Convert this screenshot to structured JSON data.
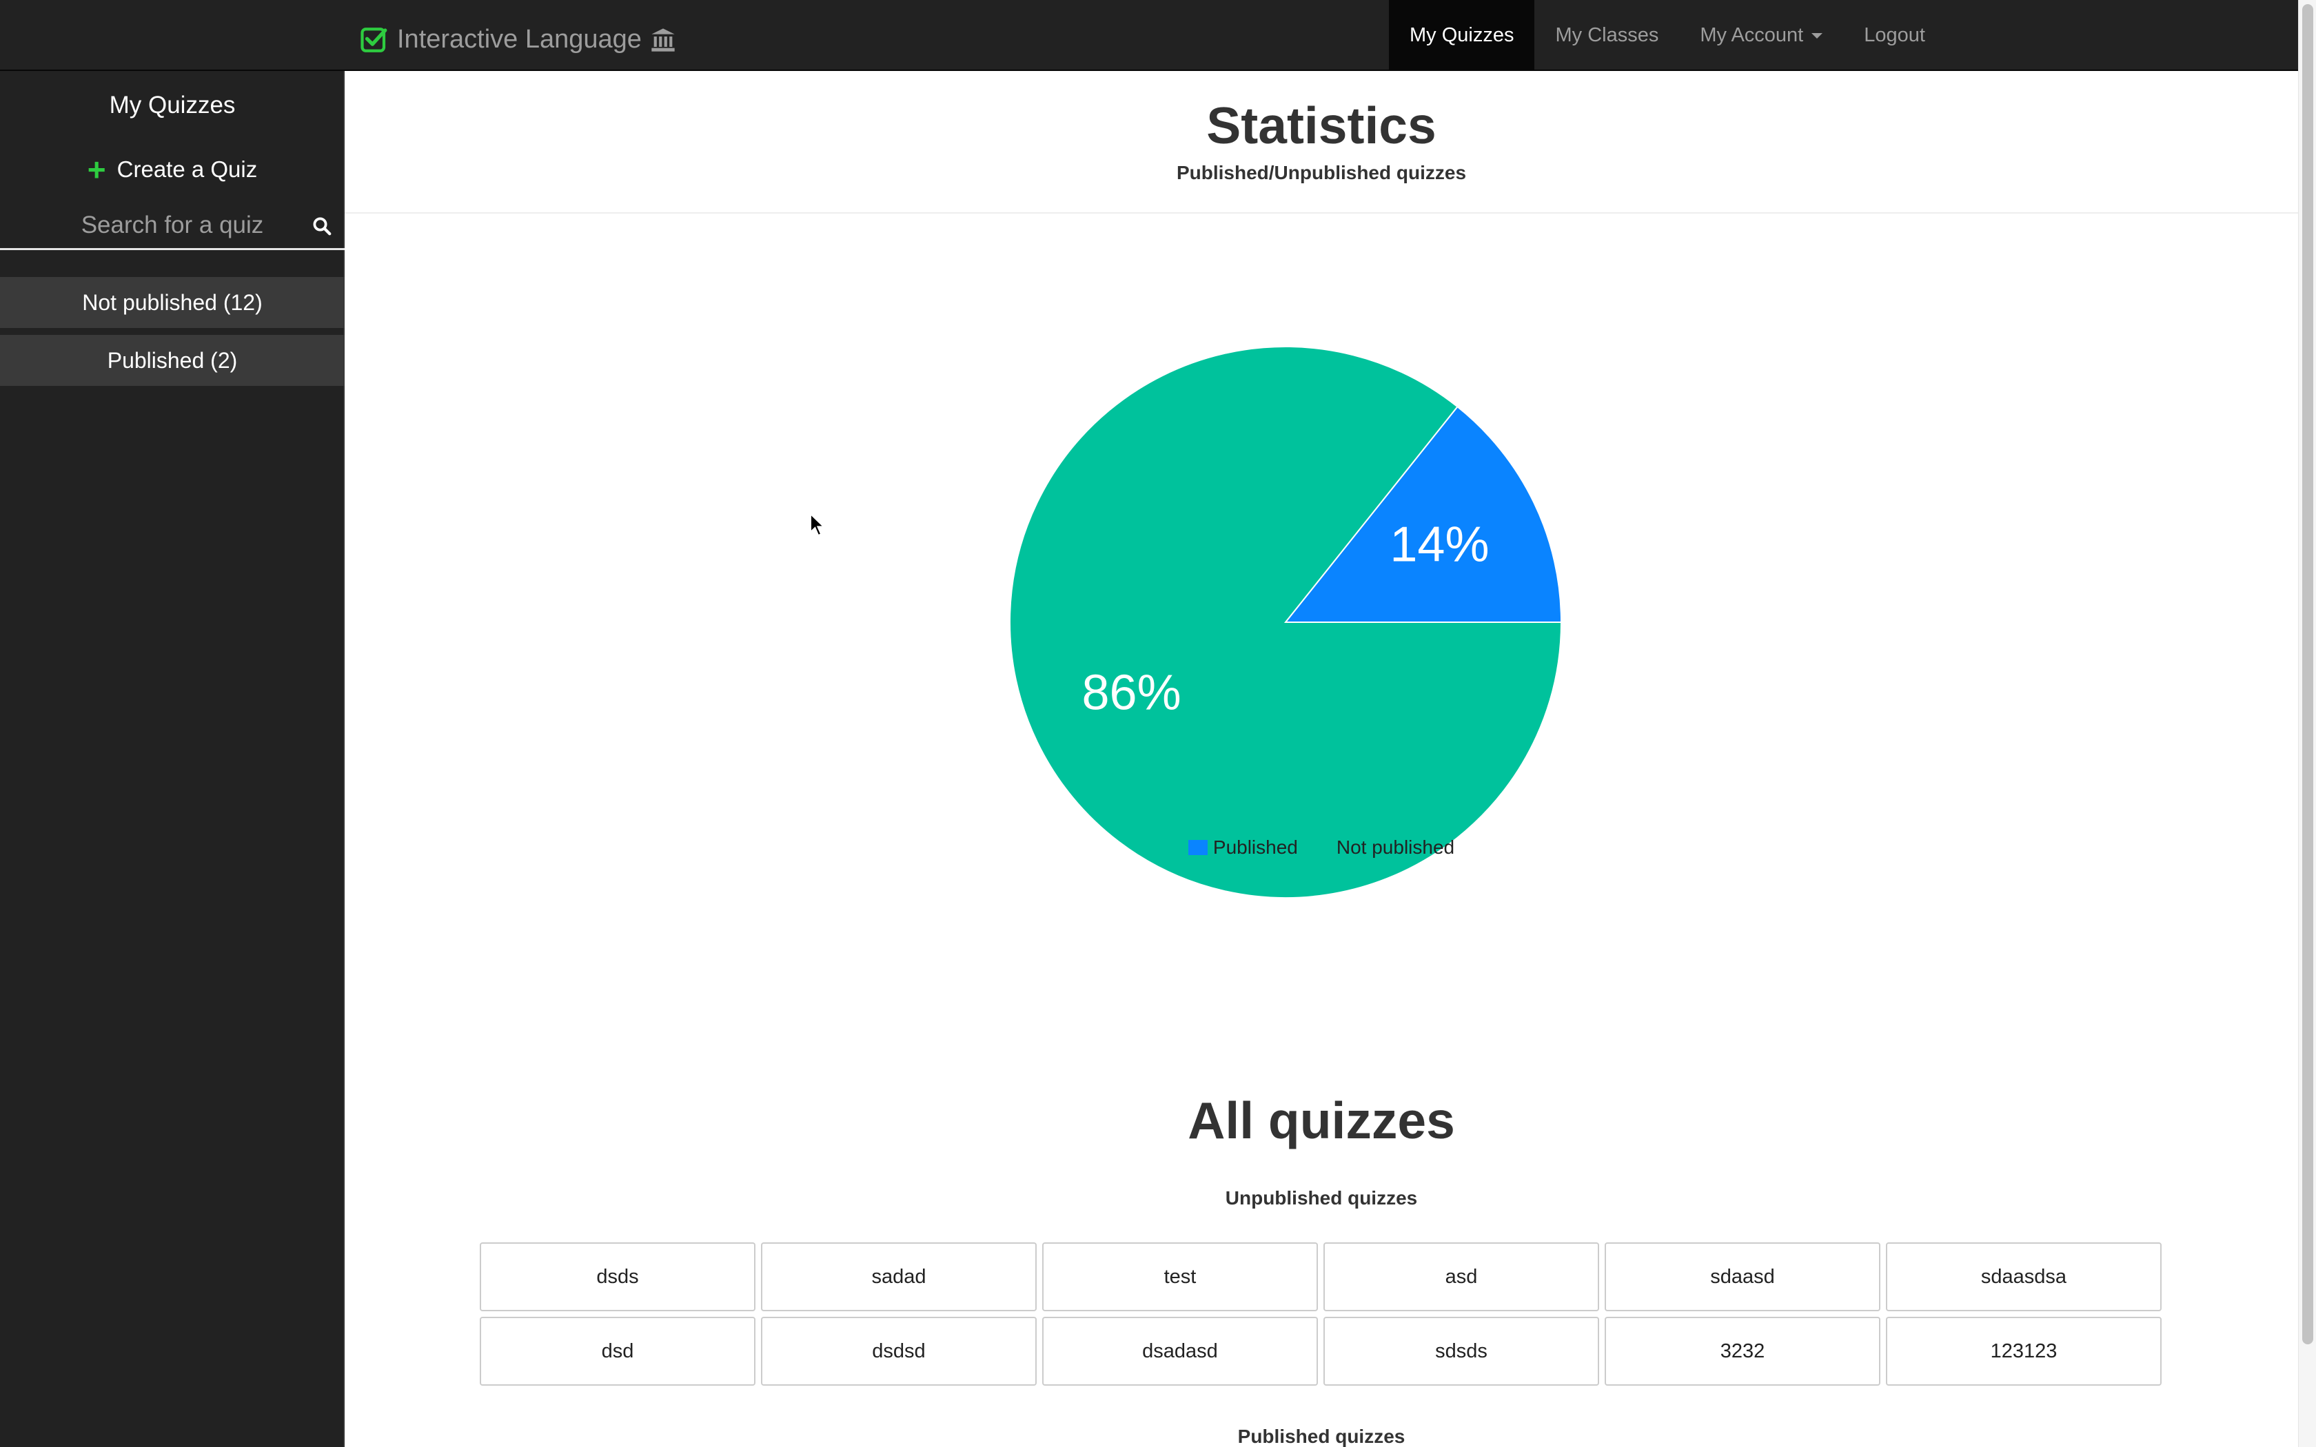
{
  "navbar": {
    "brand": "Interactive Language",
    "items": [
      {
        "label": "My Quizzes",
        "active": true
      },
      {
        "label": "My Classes"
      },
      {
        "label": "My Account",
        "dropdown": true
      },
      {
        "label": "Logout"
      }
    ]
  },
  "sidebar": {
    "title": "My Quizzes",
    "create_label": "Create a Quiz",
    "search_placeholder": "Search for a quiz",
    "filters": [
      {
        "label": "Not published (12)"
      },
      {
        "label": "Published (2)"
      }
    ]
  },
  "main": {
    "stats_title": "Statistics",
    "stats_subtitle": "Published/Unpublished quizzes",
    "all_title": "All quizzes",
    "unpublished_heading": "Unpublished quizzes",
    "published_heading": "Published quizzes",
    "unpublished_quizzes": [
      "dsds",
      "sadad",
      "test",
      "asd",
      "sdaasd",
      "sdaasdsa",
      "dsd",
      "dsdsd",
      "dsadasd",
      "sdsds",
      "3232",
      "123123"
    ]
  },
  "chart_data": {
    "type": "pie",
    "title": "",
    "series": [
      {
        "name": "Published",
        "value": 2,
        "label": "14%",
        "color": "#0a84ff"
      },
      {
        "name": "Not published",
        "value": 12,
        "label": "86%",
        "color": "#00c29c"
      }
    ],
    "legend": "bottom"
  },
  "colors": {
    "navbar_bg": "#222222",
    "sidebar_bg": "#222222",
    "accent_green": "#2ecc40"
  },
  "icons": [
    "check-square-icon",
    "bank-icon",
    "plus-icon",
    "search-icon",
    "caret-down-icon"
  ]
}
